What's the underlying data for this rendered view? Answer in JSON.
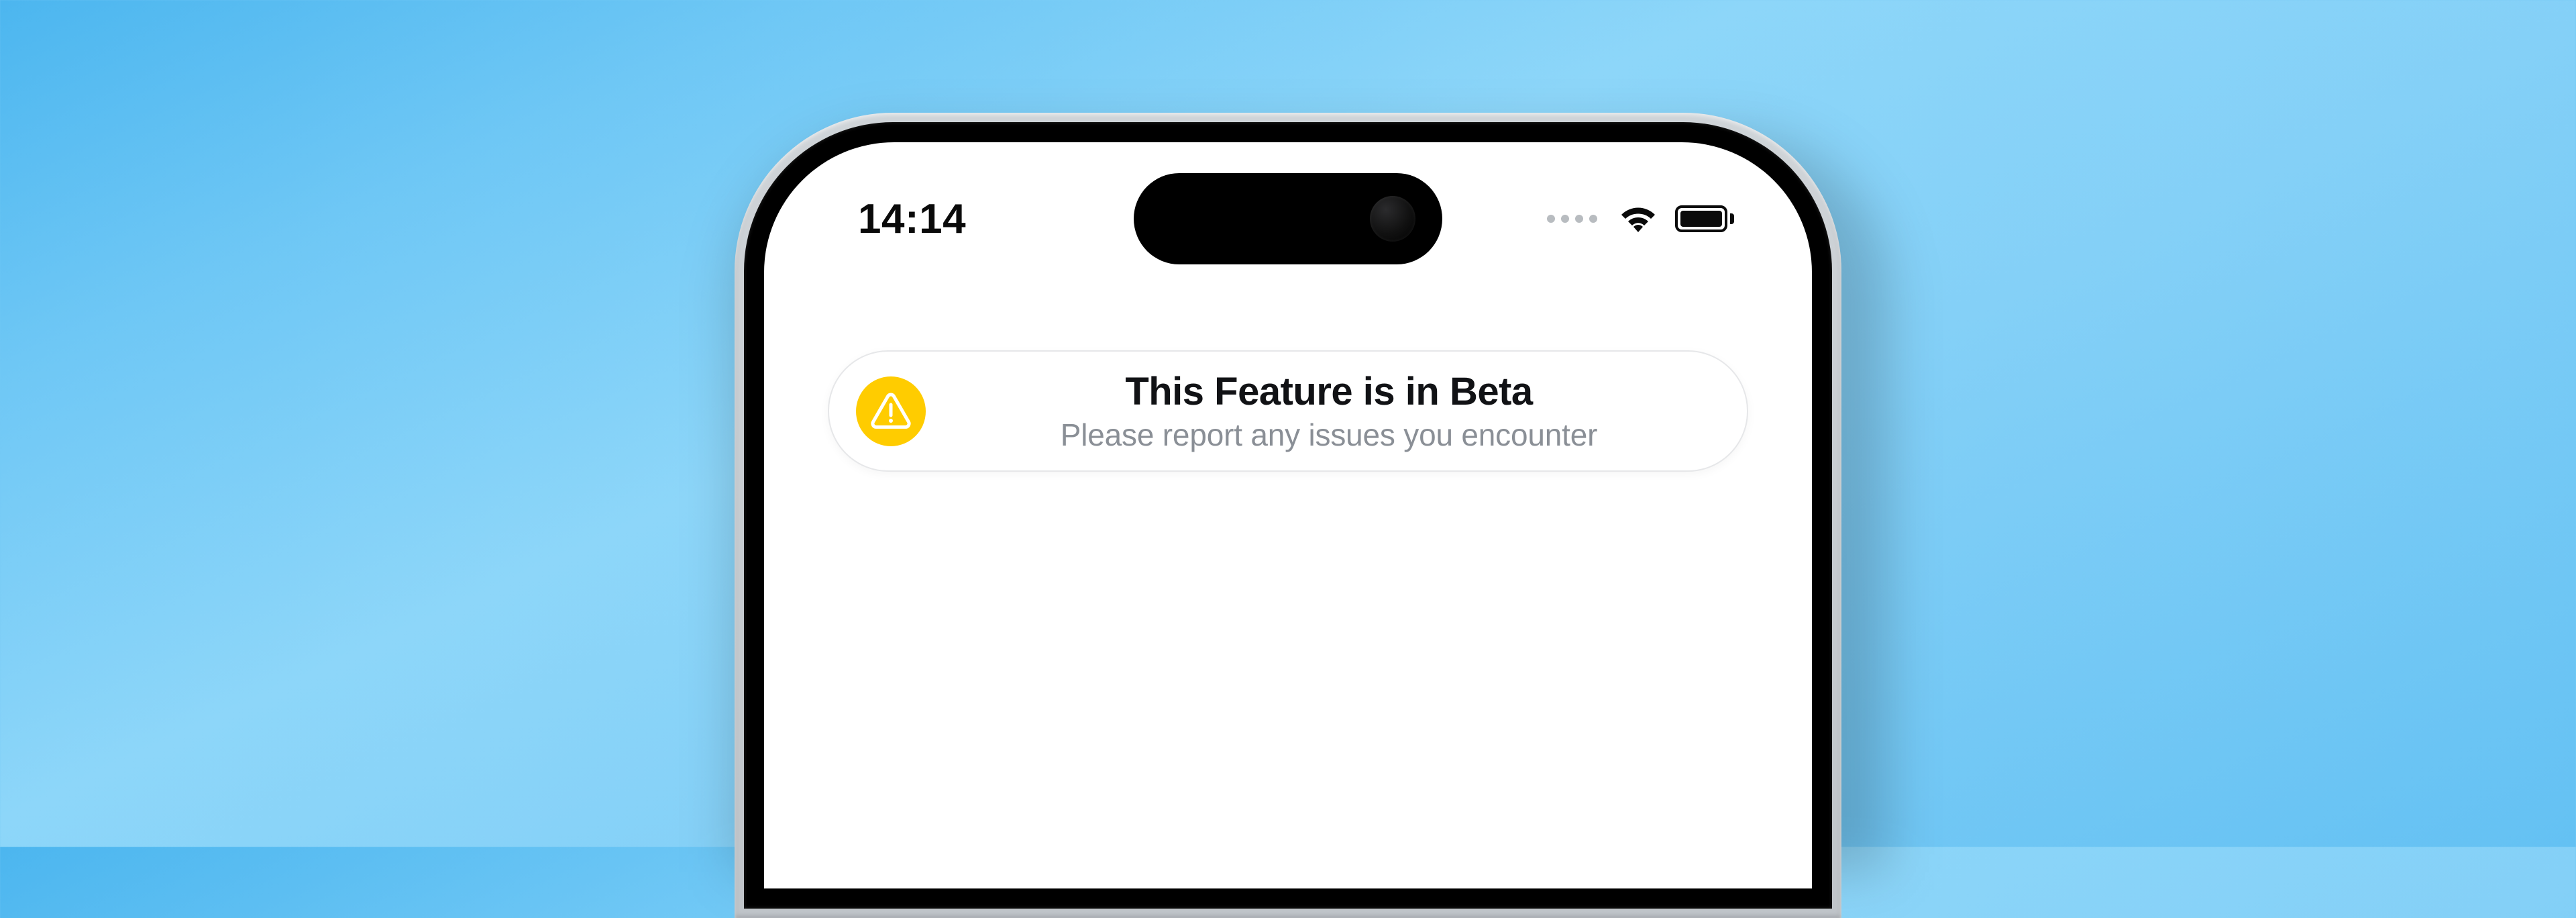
{
  "status": {
    "time": "14:14"
  },
  "banner": {
    "title": "This Feature is in Beta",
    "subtitle": "Please report any issues you encounter",
    "icon_name": "warning-triangle"
  },
  "colors": {
    "accent_warning": "#ffcc00",
    "text_primary": "#111215",
    "text_secondary": "#8a8f96",
    "background_gradient_from": "#4cb6ef",
    "background_gradient_to": "#64c1f3"
  }
}
